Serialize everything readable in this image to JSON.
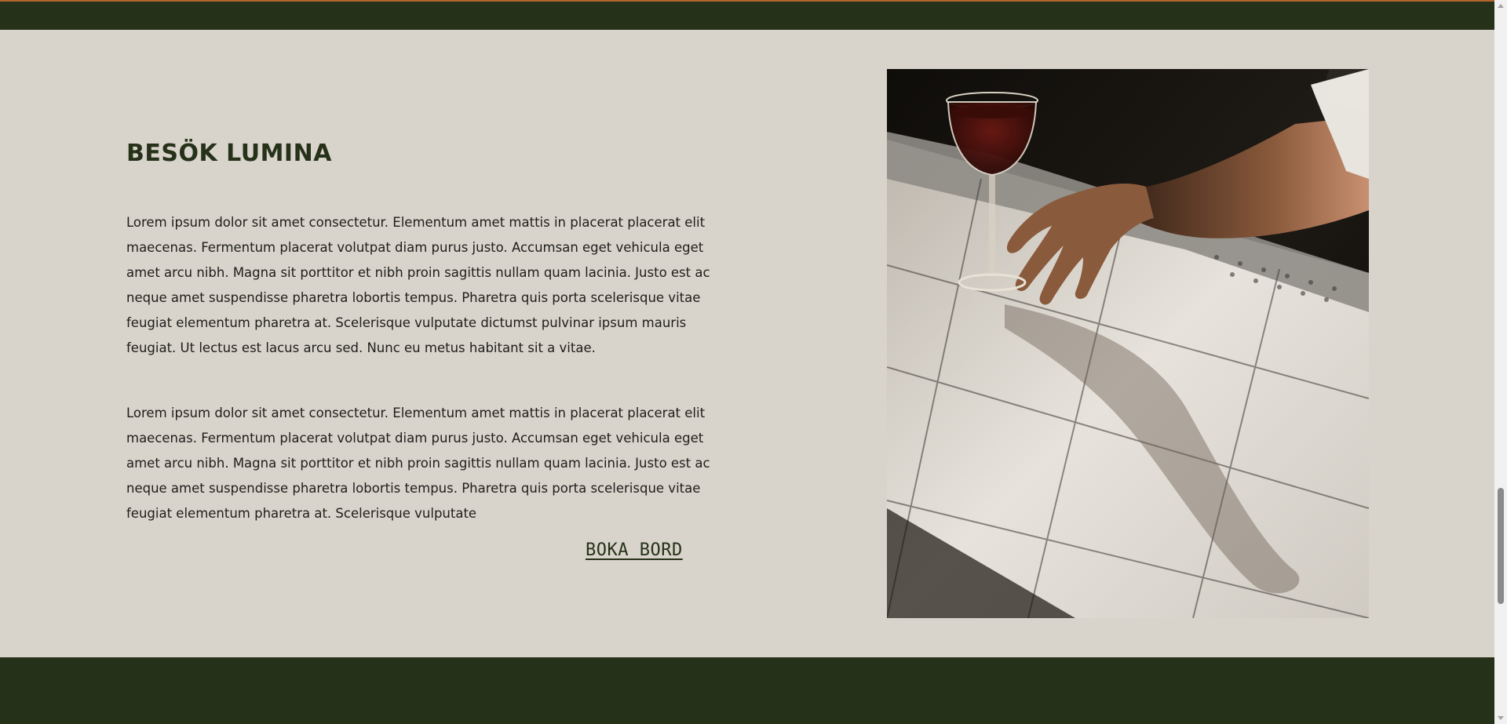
{
  "section": {
    "heading": "BESÖK LUMINA",
    "paragraph_1": "Lorem ipsum dolor sit amet consectetur. Elementum amet mattis in placerat placerat elit maecenas. Fermentum placerat volutpat diam purus justo. Accumsan eget vehicula eget amet arcu nibh. Magna sit porttitor et nibh proin sagittis nullam quam lacinia. Justo est ac neque amet suspendisse pharetra lobortis tempus. Pharetra quis porta scelerisque vitae feugiat elementum pharetra at. Scelerisque vulputate dictumst pulvinar ipsum mauris feugiat. Ut lectus est lacus arcu sed. Nunc eu metus habitant sit a vitae.",
    "paragraph_2": "Lorem ipsum dolor sit amet consectetur. Elementum amet mattis in placerat placerat elit maecenas. Fermentum placerat volutpat diam purus justo. Accumsan eget vehicula eget amet arcu nibh. Magna sit porttitor et nibh proin sagittis nullam quam lacinia. Justo est ac neque amet suspendisse pharetra lobortis tempus. Pharetra quis porta scelerisque vitae feugiat elementum pharetra at. Scelerisque vulputate",
    "cta_label": "BOKA BORD"
  },
  "colors": {
    "background": "#d8d3cb",
    "dark_green": "#263119",
    "accent": "#b5652d",
    "text": "#1e1e1a"
  },
  "image": {
    "subject": "hand-holding-wine-glass-on-tiled-bar"
  }
}
